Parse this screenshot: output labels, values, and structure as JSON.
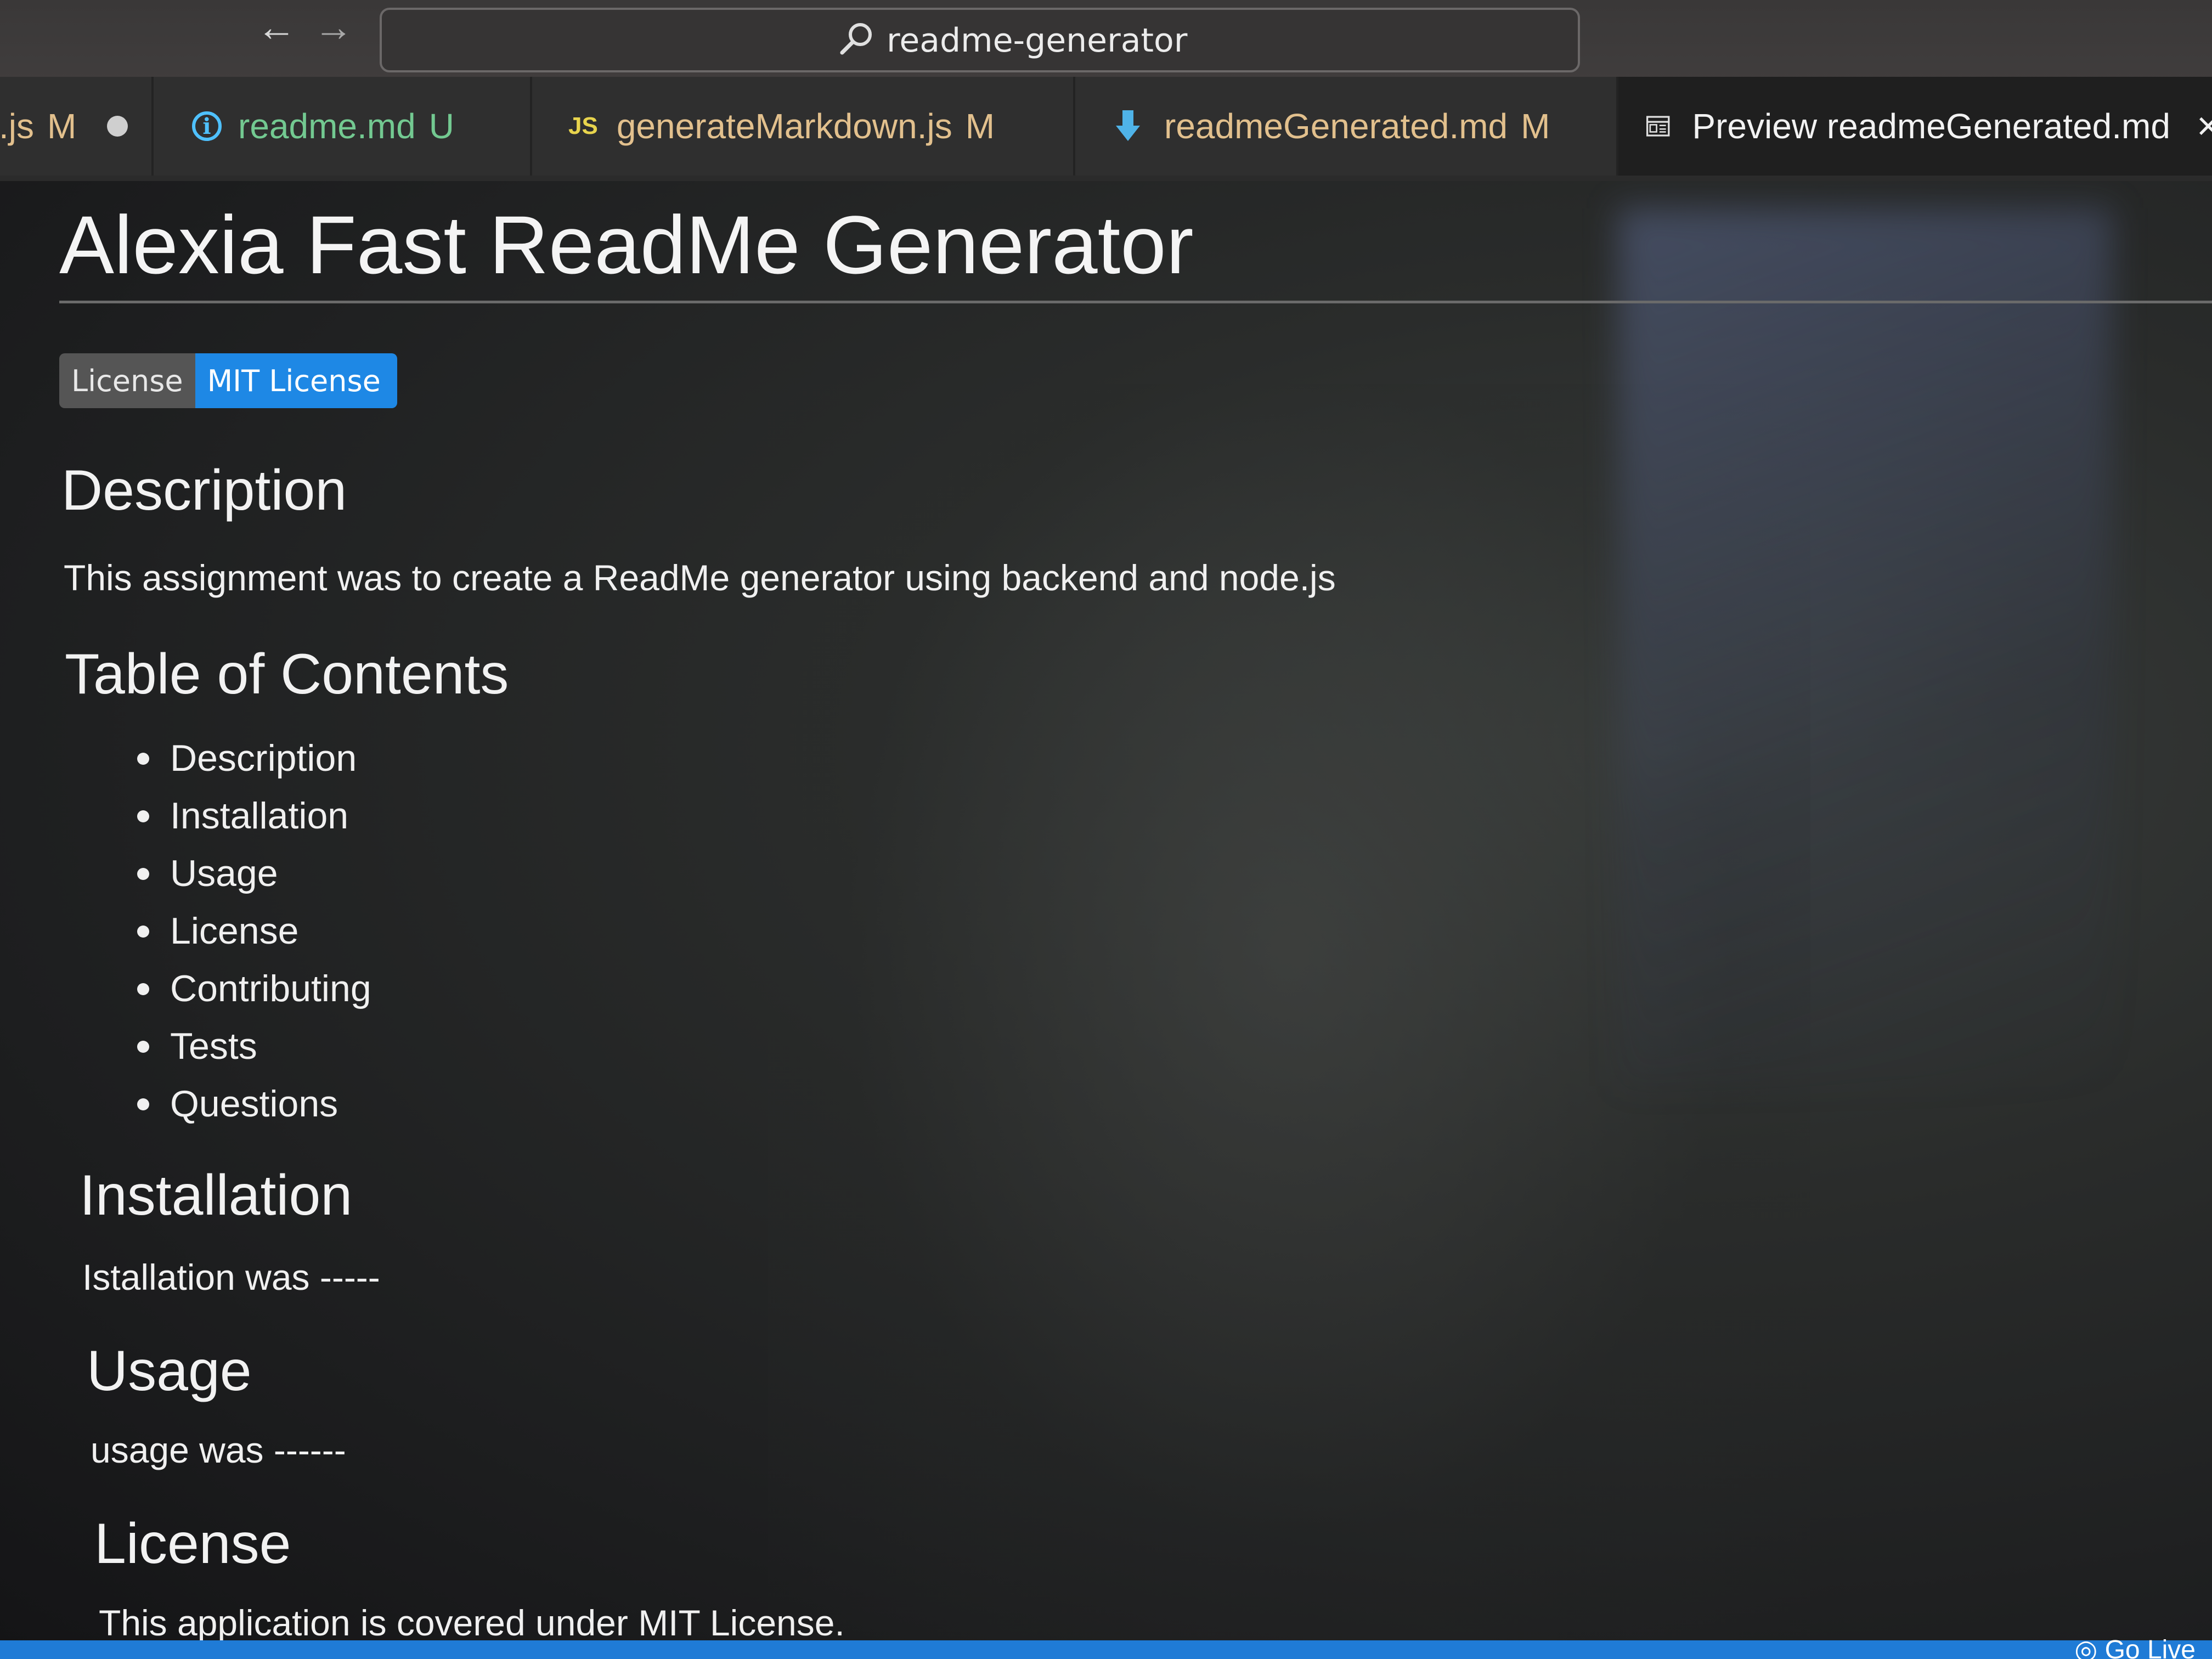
{
  "titlebar": {
    "back_icon": "arrow-left-icon",
    "forward_icon": "arrow-right-icon",
    "search_text": "readme-generator"
  },
  "tabs": [
    {
      "label": ".js",
      "status": "M",
      "modified_dot": true
    },
    {
      "label": "readme.md",
      "status": "U",
      "icon": "info-icon"
    },
    {
      "label": "generateMarkdown.js",
      "status": "M",
      "icon": "js-file-icon"
    },
    {
      "label": "readmeGenerated.md",
      "status": "M",
      "icon": "markdown-download-icon"
    },
    {
      "label": "Preview readmeGenerated.md",
      "icon": "preview-icon",
      "active": true
    }
  ],
  "preview": {
    "title": "Alexia Fast ReadMe Generator",
    "badge": {
      "left": "License",
      "right": "MIT License"
    },
    "sections": {
      "description": {
        "heading": "Description",
        "text": "This assignment was to create a ReadMe generator using backend and node.js"
      },
      "toc": {
        "heading": "Table of Contents",
        "items": [
          "Description",
          "Installation",
          "Usage",
          "License",
          "Contributing",
          "Tests",
          "Questions"
        ]
      },
      "installation": {
        "heading": "Installation",
        "text": "Istallation was -----"
      },
      "usage": {
        "heading": "Usage",
        "text": "usage was ------"
      },
      "license": {
        "heading": "License",
        "text": "This application is covered under MIT License."
      }
    }
  },
  "statusbar": {
    "golive": "Go Live"
  },
  "colors": {
    "accent_blue": "#1e88e5",
    "git_modified": "#e2c08d",
    "git_untracked": "#73c991",
    "statusbar": "#1f7bd6"
  }
}
